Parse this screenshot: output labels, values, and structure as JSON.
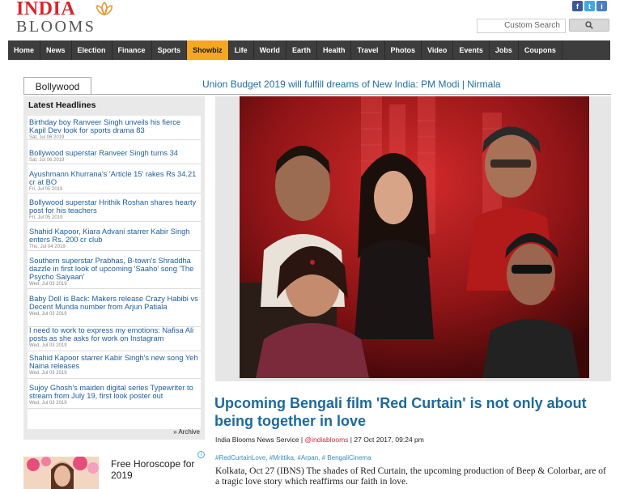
{
  "brand": {
    "line1": "INDIA",
    "line2": "BLOOMS",
    "colors": {
      "red": "#d9262b",
      "gray": "#555555"
    }
  },
  "social": [
    {
      "name": "facebook-icon",
      "glyph": "f"
    },
    {
      "name": "twitter-icon",
      "glyph": "t"
    },
    {
      "name": "instagram-icon",
      "glyph": "i"
    }
  ],
  "search": {
    "placeholder": "Custom Search",
    "icon": "search-icon"
  },
  "nav": {
    "active": "Showbiz",
    "items": [
      "Home",
      "News",
      "Election",
      "Finance",
      "Sports",
      "Showbiz",
      "Life",
      "World",
      "Earth",
      "Health",
      "Travel",
      "Photos",
      "Video",
      "Events",
      "Jobs",
      "Coupons"
    ]
  },
  "category_tab": "Bollywood",
  "ticker": "Union Budget 2019 will fulfill dreams of New India: PM Modi | Nirmala",
  "sidebar": {
    "title": "Latest Headlines",
    "archive": "» Archive",
    "headlines": [
      {
        "text": "Birthday boy Ranveer Singh unveils his fierce Kapil Dev look for sports drama 83",
        "date": "Sat, Jul 06 2019"
      },
      {
        "text": "Bollywood superstar Ranveer Singh turns 34",
        "date": "Sat, Jul 06 2019"
      },
      {
        "text": "Ayushmann Khurrana’s 'Article 15' rakes Rs 34.21 cr at BO",
        "date": "Fri, Jul 05 2019"
      },
      {
        "text": "Bollywood superstar Hrithik Roshan shares hearty post for his teachers",
        "date": "Fri, Jul 05 2019"
      },
      {
        "text": "Shahid Kapoor, Kiara Advani starrer Kabir Singh enters Rs. 200 cr club",
        "date": "Thu, Jul 04 2019"
      },
      {
        "text": "Southern superstar Prabhas, B-town’s Shraddha dazzle in first look of upcoming 'Saaho' song 'The Psycho Saiyaan'",
        "date": "Wed, Jul 03 2019"
      },
      {
        "text": "Baby Doll is Back: Makers release Crazy Habibi vs Decent Munda number from Arjun Patiala",
        "date": "Wed, Jul 03 2019"
      },
      {
        "text": "I need to work to express my emotions: Nafisa Ali posts as she asks for work on Instagram",
        "date": "Wed, Jul 03 2019"
      },
      {
        "text": "Shahid Kapoor starrer Kabir Singh's new song Yeh Naina releases",
        "date": "Wed, Jul 03 2019"
      },
      {
        "text": "Sujoy Ghosh’s maiden digital series Typewriter to stream from July 19, first look poster out",
        "date": "Wed, Jul 03 2019"
      }
    ]
  },
  "promo": {
    "text": "Free Horoscope for 2019",
    "info": "i"
  },
  "article": {
    "title": "Upcoming Bengali film 'Red Curtain' is not only about being together in love",
    "source": "India Blooms News Service",
    "handle": "@indiablooms",
    "datetime": "27 Oct 2017, 09:24 pm",
    "tags": "#RedCurtainLove, #Mrittika, #Arpan, # BengaliCinema",
    "lede": "Kolkata, Oct 27 (IBNS) The shades of Red Curtain, the upcoming production of Beep & Colorbar, are of a tragic love story which reaffirms our faith in love."
  },
  "colors": {
    "nav_bg": "#3d3d3d",
    "nav_active": "#f5a623",
    "link_blue": "#1d5d9a",
    "title_blue": "#1c6a9c",
    "hero_red": "#b01a1f"
  }
}
